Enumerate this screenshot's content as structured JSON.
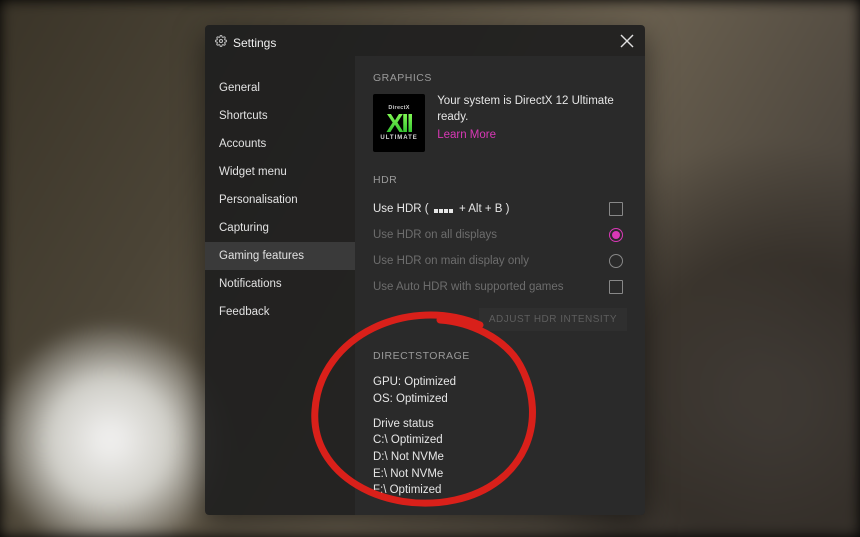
{
  "window": {
    "title": "Settings"
  },
  "sidebar": {
    "items": [
      {
        "label": "General"
      },
      {
        "label": "Shortcuts"
      },
      {
        "label": "Accounts"
      },
      {
        "label": "Widget menu"
      },
      {
        "label": "Personalisation"
      },
      {
        "label": "Capturing"
      },
      {
        "label": "Gaming features"
      },
      {
        "label": "Notifications"
      },
      {
        "label": "Feedback"
      }
    ],
    "active_index": 6
  },
  "graphics": {
    "header": "GRAPHICS",
    "badge_top": "DirectX",
    "badge_mid": "XII",
    "badge_bot": "ULTIMATE",
    "status_line": "Your system is DirectX 12 Ultimate ready.",
    "learn_more": "Learn More"
  },
  "hdr": {
    "header": "HDR",
    "use_hdr_prefix": "Use HDR ( ",
    "use_hdr_suffix": " + Alt + B )",
    "opt_all": "Use HDR on all displays",
    "opt_main": "Use HDR on main display only",
    "opt_auto": "Use Auto HDR with supported games",
    "adjust_button": "ADJUST HDR INTENSITY"
  },
  "directstorage": {
    "header": "DIRECTSTORAGE",
    "gpu": "GPU: Optimized",
    "os": "OS: Optimized",
    "drive_header": "Drive status",
    "drives": [
      "C:\\ Optimized",
      "D:\\ Not NVMe",
      "E:\\ Not NVMe",
      "F:\\ Optimized"
    ]
  }
}
